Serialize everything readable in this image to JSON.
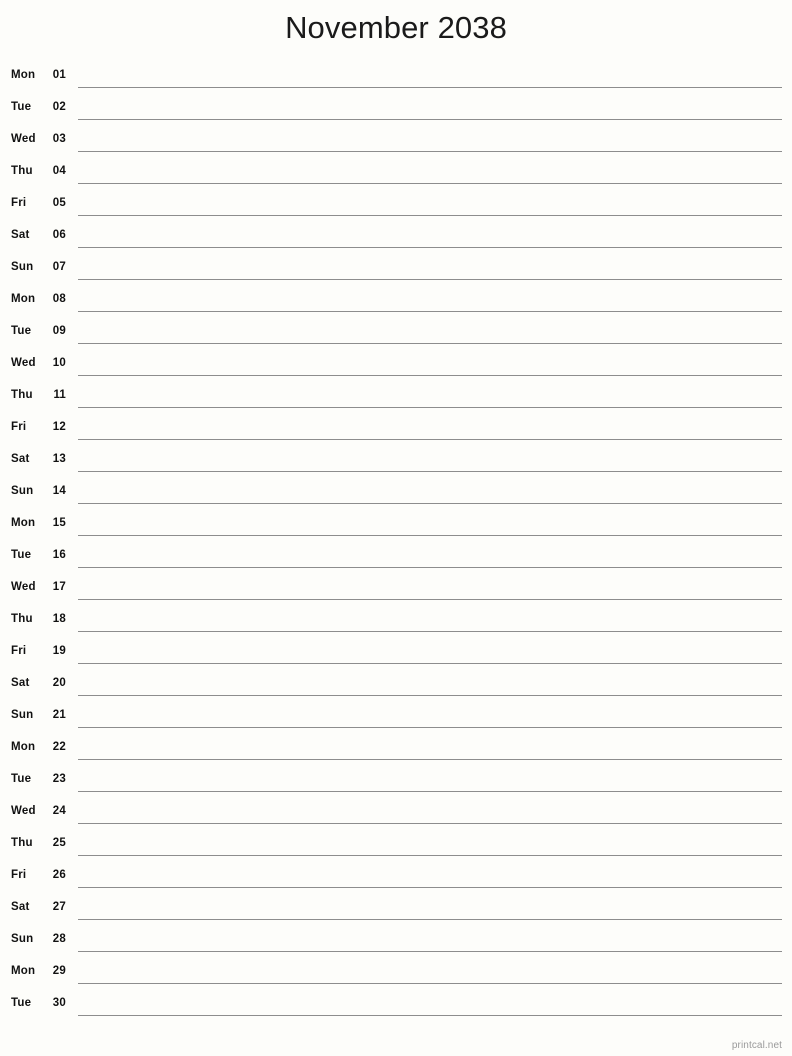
{
  "document": {
    "title": "November 2038",
    "month": "November",
    "year": "2038",
    "background_color": "#fdfdfa",
    "text_color": "#111111",
    "rule_color": "#8d8d8d"
  },
  "footer": {
    "credit": "printcal.net",
    "color": "#9a9a9a"
  },
  "days": [
    {
      "dow": "Mon",
      "num": "01"
    },
    {
      "dow": "Tue",
      "num": "02"
    },
    {
      "dow": "Wed",
      "num": "03"
    },
    {
      "dow": "Thu",
      "num": "04"
    },
    {
      "dow": "Fri",
      "num": "05"
    },
    {
      "dow": "Sat",
      "num": "06"
    },
    {
      "dow": "Sun",
      "num": "07"
    },
    {
      "dow": "Mon",
      "num": "08"
    },
    {
      "dow": "Tue",
      "num": "09"
    },
    {
      "dow": "Wed",
      "num": "10"
    },
    {
      "dow": "Thu",
      "num": "11"
    },
    {
      "dow": "Fri",
      "num": "12"
    },
    {
      "dow": "Sat",
      "num": "13"
    },
    {
      "dow": "Sun",
      "num": "14"
    },
    {
      "dow": "Mon",
      "num": "15"
    },
    {
      "dow": "Tue",
      "num": "16"
    },
    {
      "dow": "Wed",
      "num": "17"
    },
    {
      "dow": "Thu",
      "num": "18"
    },
    {
      "dow": "Fri",
      "num": "19"
    },
    {
      "dow": "Sat",
      "num": "20"
    },
    {
      "dow": "Sun",
      "num": "21"
    },
    {
      "dow": "Mon",
      "num": "22"
    },
    {
      "dow": "Tue",
      "num": "23"
    },
    {
      "dow": "Wed",
      "num": "24"
    },
    {
      "dow": "Thu",
      "num": "25"
    },
    {
      "dow": "Fri",
      "num": "26"
    },
    {
      "dow": "Sat",
      "num": "27"
    },
    {
      "dow": "Sun",
      "num": "28"
    },
    {
      "dow": "Mon",
      "num": "29"
    },
    {
      "dow": "Tue",
      "num": "30"
    }
  ]
}
